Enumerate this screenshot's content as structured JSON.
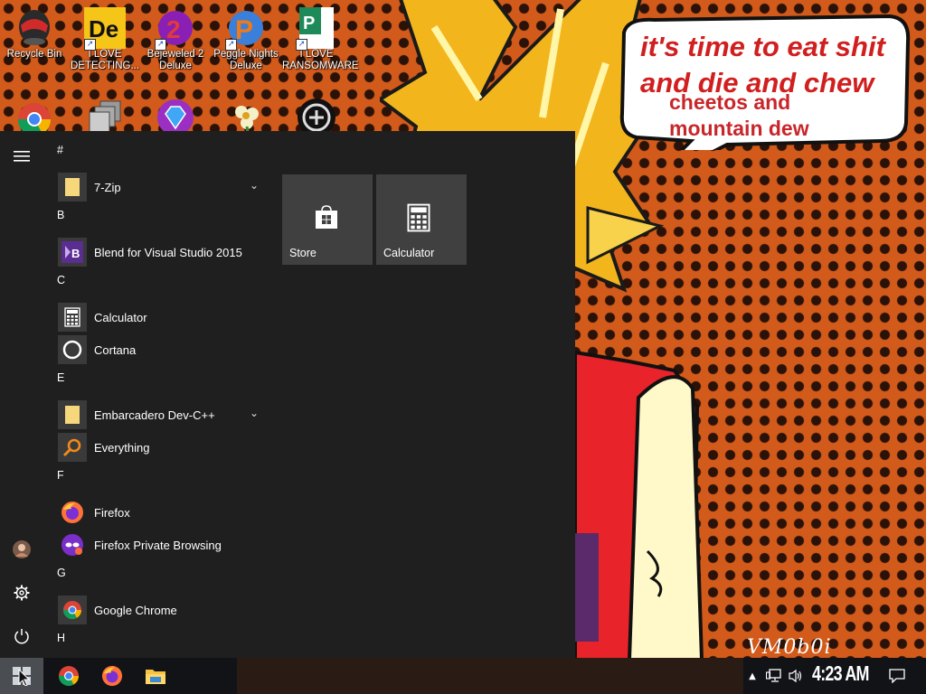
{
  "wallpaper": {
    "speech_lines": [
      "it's time to eat shit",
      "and die and chew",
      "cheetos and",
      "mountain dew"
    ],
    "signature": "VM0b0i"
  },
  "desktop_icons": [
    {
      "name": "recycle-bin-icon",
      "label": "Recycle Bin"
    },
    {
      "name": "i-love-detecting-icon",
      "label": "I LOVE DETECTING..."
    },
    {
      "name": "bejeweled-2-deluxe-icon",
      "label": "Bejeweled 2 Deluxe"
    },
    {
      "name": "peggle-nights-deluxe-icon",
      "label": "Peggle Nights Deluxe"
    },
    {
      "name": "i-love-ransomware-icon",
      "label": "I LOVE RANSOMWARE"
    }
  ],
  "start_menu": {
    "groups": [
      {
        "header": "#",
        "apps": [
          {
            "label": "7-Zip",
            "icon": "folder-icon",
            "expandable": true
          }
        ]
      },
      {
        "header": "B",
        "apps": [
          {
            "label": "Blend for Visual Studio 2015",
            "icon": "blend-icon"
          }
        ]
      },
      {
        "header": "C",
        "apps": [
          {
            "label": "Calculator",
            "icon": "calculator-icon"
          },
          {
            "label": "Cortana",
            "icon": "cortana-icon"
          }
        ]
      },
      {
        "header": "E",
        "apps": [
          {
            "label": "Embarcadero Dev-C++",
            "icon": "folder-icon",
            "expandable": true
          },
          {
            "label": "Everything",
            "icon": "everything-search-icon"
          }
        ]
      },
      {
        "header": "F",
        "apps": [
          {
            "label": "Firefox",
            "icon": "firefox-icon"
          },
          {
            "label": "Firefox Private Browsing",
            "icon": "firefox-private-icon"
          }
        ]
      },
      {
        "header": "G",
        "apps": [
          {
            "label": "Google Chrome",
            "icon": "chrome-icon"
          }
        ]
      },
      {
        "header": "H",
        "apps": []
      }
    ],
    "tiles": [
      {
        "label": "Store",
        "icon": "store-icon"
      },
      {
        "label": "Calculator",
        "icon": "calculator-icon"
      }
    ]
  },
  "taskbar": {
    "pinned": [
      "chrome-icon",
      "firefox-icon",
      "file-explorer-icon"
    ],
    "clock": "4:23 AM"
  },
  "colors": {
    "start_bg": "#1f1f1f",
    "tile_bg": "#404040",
    "taskbar_bg": "#111317",
    "speech_text": "#d11f1f",
    "wallpaper_orange": "#d25a1a"
  }
}
